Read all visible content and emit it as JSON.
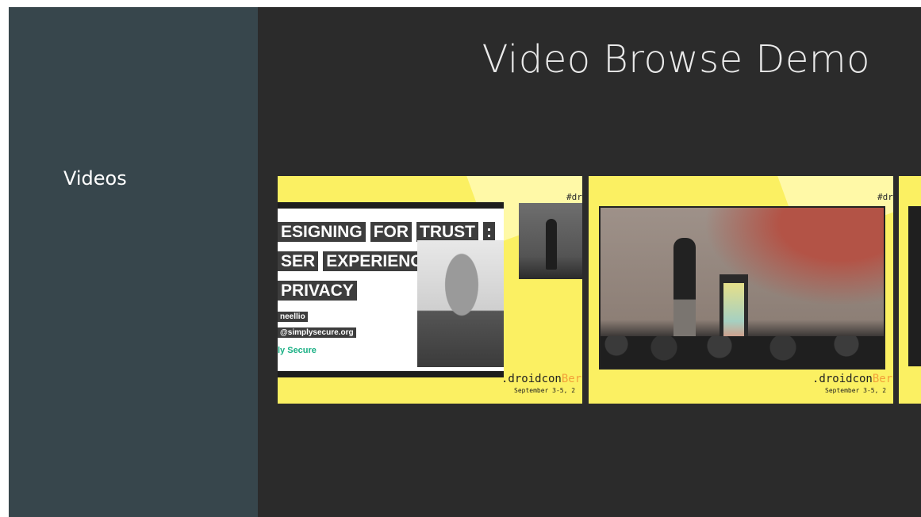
{
  "sidebar": {
    "header": "Videos"
  },
  "header": {
    "title": "Video Browse Demo"
  },
  "cards": [
    {
      "hashtag": "#dro",
      "slide": {
        "lines": [
          [
            "ESIGNING",
            "FOR",
            "TRUST",
            ":"
          ],
          [
            "SER",
            "EXPERIENCE"
          ],
          [
            "PRIVACY"
          ]
        ],
        "handle": "neellio",
        "email": "@simplysecure.org",
        "org": "ly Secure"
      },
      "brand_prefix": ".droidcon",
      "brand_accent": "Berl",
      "dates": "September 3-5, 2"
    },
    {
      "hashtag": "#dro",
      "brand_prefix": ".droidcon",
      "brand_accent": "Berl",
      "dates": "September 3-5, 2"
    },
    {}
  ],
  "colors": {
    "sidebar_bg": "#37464c",
    "content_bg": "#2b2b2b",
    "card_bg": "#fbf062",
    "accent": "#f2a23a"
  }
}
